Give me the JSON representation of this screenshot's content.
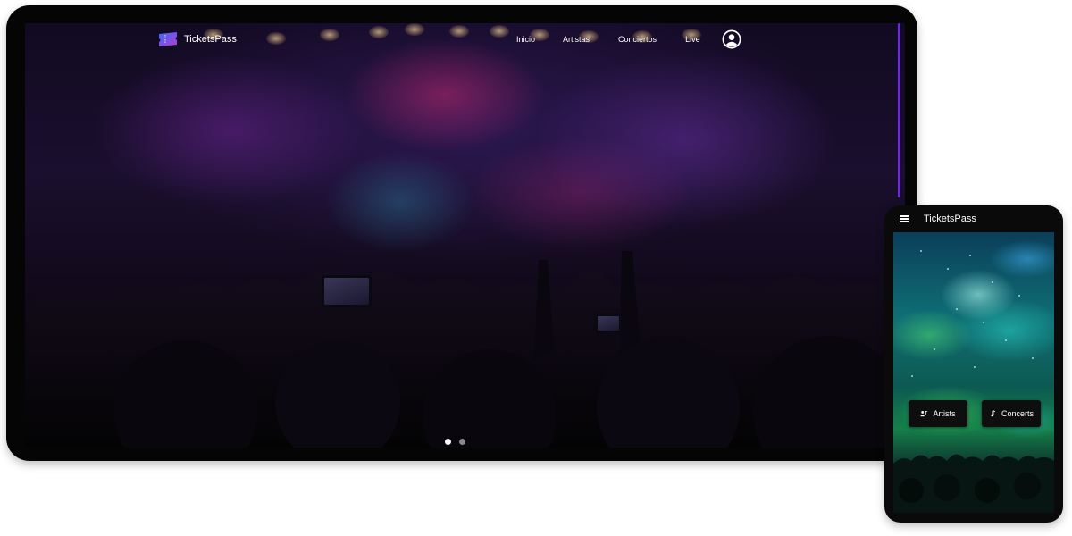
{
  "desktop": {
    "brand": "TicketsPass",
    "nav": {
      "links": [
        "Inicio",
        "Artistas",
        "Conciertos",
        "Live"
      ]
    },
    "icons": {
      "logo": "ticket-icon",
      "user": "user-circle-icon"
    },
    "carousel": {
      "slides": 2,
      "active_index": 0
    },
    "colors": {
      "scrollbar_accent": "#6c2bd9",
      "logo_gradient": [
        "#3b6cf6",
        "#b43bd6"
      ]
    }
  },
  "mobile": {
    "title": "TicketsPass",
    "icons": {
      "menu": "hamburger-menu-icon",
      "artists": "group-icon",
      "concerts": "music-note-icon"
    },
    "buttons": {
      "artists_label": "Artists",
      "concerts_label": "Concerts"
    }
  }
}
